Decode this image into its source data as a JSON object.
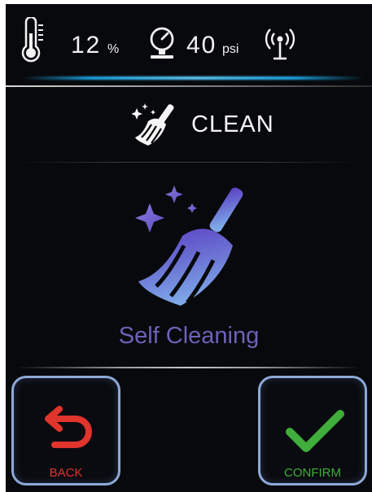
{
  "status_bar": {
    "humidity_value": "12",
    "humidity_unit": "%",
    "pressure_value": "40",
    "pressure_unit": "psi",
    "icons": [
      "thermometer-icon",
      "pressure-gauge-icon",
      "antenna-icon"
    ]
  },
  "header": {
    "title": "CLEAN",
    "icon": "broom-sparkle-icon"
  },
  "main": {
    "icon": "broom-sparkle-icon",
    "label": "Self Cleaning",
    "label_color": "#6a63b8"
  },
  "buttons": {
    "back_label": "BACK",
    "back_color": "#e0342c",
    "confirm_label": "CONFIRM",
    "confirm_color": "#3fae3a"
  }
}
